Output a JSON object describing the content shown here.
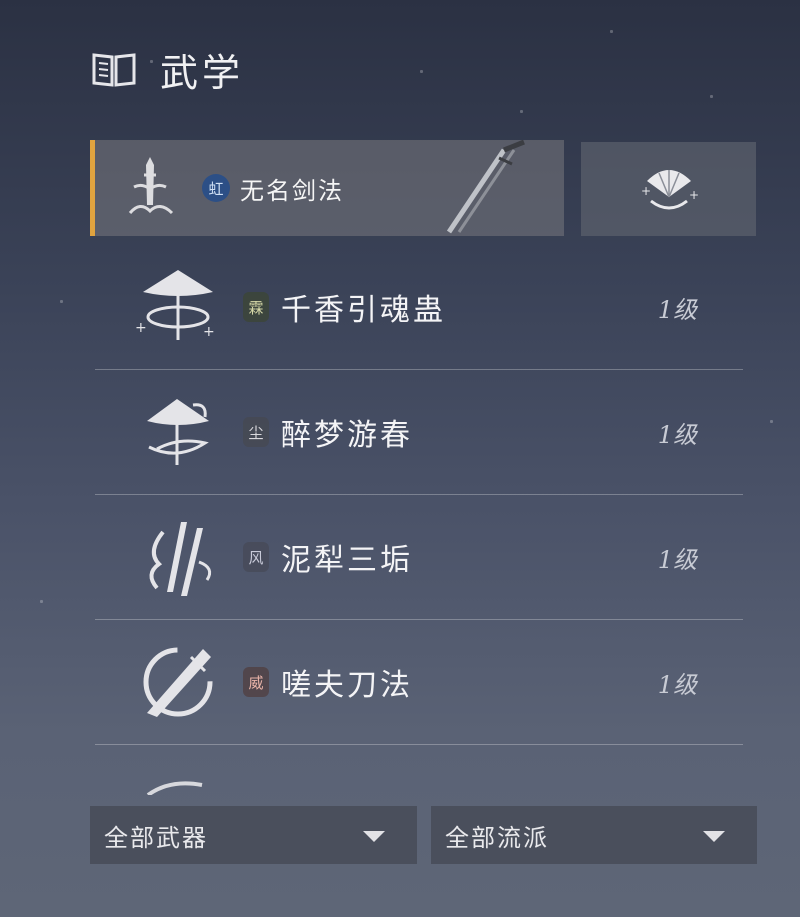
{
  "header": {
    "title": "武学",
    "icon": "book-icon"
  },
  "selected": {
    "badge": "虹",
    "name": "无名剑法",
    "icon": "sword-stance-icon",
    "art": "sword-icon",
    "accent": "#e0a33f"
  },
  "side_card": {
    "icon": "fan-icon"
  },
  "skills": [
    {
      "badge": "霖",
      "name": "千香引魂蛊",
      "level": "1级",
      "icon": "umbrella-icon"
    },
    {
      "badge": "尘",
      "name": "醉梦游春",
      "level": "1级",
      "icon": "umbrella-swirl-icon"
    },
    {
      "badge": "风",
      "name": "泥犁三垢",
      "level": "1级",
      "icon": "claw-icon"
    },
    {
      "badge": "威",
      "name": "嗟夫刀法",
      "level": "1级",
      "icon": "blade-slash-icon"
    }
  ],
  "filters": {
    "weapon": "全部武器",
    "school": "全部流派"
  }
}
